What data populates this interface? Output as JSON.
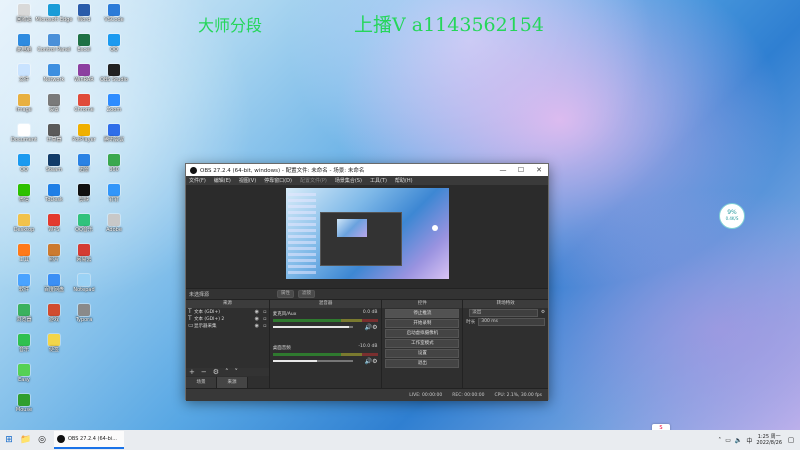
{
  "overlay": {
    "left_text": "大师分段",
    "right_text": "上播V a1143562154"
  },
  "desktop_icons": [
    {
      "label": "回收站",
      "icon": "recycle-bin-icon",
      "color": "#d9d9d9",
      "col": 0,
      "row": 0
    },
    {
      "label": "此电脑",
      "icon": "computer-icon",
      "color": "#2e8be0",
      "col": 0,
      "row": 1
    },
    {
      "label": "文件",
      "icon": "file-icon",
      "color": "#c9e3ff",
      "col": 0,
      "row": 2
    },
    {
      "label": "Image",
      "icon": "image-icon",
      "color": "#e8b040",
      "col": 0,
      "row": 3
    },
    {
      "label": "Document",
      "icon": "document-icon",
      "color": "#ffffff",
      "col": 0,
      "row": 4
    },
    {
      "label": "QQ",
      "icon": "qq-icon",
      "color": "#1b9af0",
      "col": 0,
      "row": 5
    },
    {
      "label": "微信",
      "icon": "wechat-icon",
      "color": "#2dc100",
      "col": 0,
      "row": 6
    },
    {
      "label": "Desktop",
      "icon": "folder-icon",
      "color": "#f1c24b",
      "col": 0,
      "row": 7
    },
    {
      "label": "工具",
      "icon": "tool-icon",
      "color": "#ff7a1a",
      "col": 0,
      "row": 8
    },
    {
      "label": "软件",
      "icon": "app-icon",
      "color": "#4aa3ff",
      "col": 0,
      "row": 9
    },
    {
      "label": "浏览器",
      "icon": "browser-icon",
      "color": "#3bb15e",
      "col": 0,
      "row": 10
    },
    {
      "label": "音乐",
      "icon": "music-icon",
      "color": "#30c050",
      "col": 0,
      "row": 11
    },
    {
      "label": "Easy",
      "icon": "easy-icon",
      "color": "#55d155",
      "col": 0,
      "row": 12
    },
    {
      "label": "Mouse",
      "icon": "mouse-icon",
      "color": "#2f9e2f",
      "col": 0,
      "row": 13
    },
    {
      "label": "Microsoft Edge",
      "icon": "edge-icon",
      "color": "#1a9cd8",
      "col": 1,
      "row": 0
    },
    {
      "label": "Control Panel",
      "icon": "control-panel-icon",
      "color": "#4a90d9",
      "col": 1,
      "row": 1
    },
    {
      "label": "Network",
      "icon": "network-icon",
      "color": "#3d8fe0",
      "col": 1,
      "row": 2
    },
    {
      "label": "设置",
      "icon": "settings-icon",
      "color": "#7a7a7a",
      "col": 1,
      "row": 3
    },
    {
      "label": "计算器",
      "icon": "calculator-icon",
      "color": "#5a5a5a",
      "col": 1,
      "row": 4
    },
    {
      "label": "Steam",
      "icon": "steam-icon",
      "color": "#123c6a",
      "col": 1,
      "row": 5
    },
    {
      "label": "ToDesk",
      "icon": "todesk-icon",
      "color": "#1f7fe6",
      "col": 1,
      "row": 6
    },
    {
      "label": "WPS",
      "icon": "wps-icon",
      "color": "#e33a2e",
      "col": 1,
      "row": 7
    },
    {
      "label": "照片",
      "icon": "photo-icon",
      "color": "#cc7a30",
      "col": 1,
      "row": 8
    },
    {
      "label": "百度网盘",
      "icon": "cloud-icon",
      "color": "#3b8ff5",
      "col": 1,
      "row": 9
    },
    {
      "label": "游戏",
      "icon": "game-icon",
      "color": "#d14c2f",
      "col": 1,
      "row": 10
    },
    {
      "label": "便签",
      "icon": "note-icon",
      "color": "#f3d54a",
      "col": 1,
      "row": 11
    },
    {
      "label": "Word",
      "icon": "word-icon",
      "color": "#2a5caa",
      "col": 2,
      "row": 0
    },
    {
      "label": "Excel",
      "icon": "excel-icon",
      "color": "#1e7145",
      "col": 2,
      "row": 1
    },
    {
      "label": "WinRAR",
      "icon": "winrar-icon",
      "color": "#8c3fa0",
      "col": 2,
      "row": 2
    },
    {
      "label": "Chrome",
      "icon": "chrome-icon",
      "color": "#e04b3a",
      "col": 2,
      "row": 3
    },
    {
      "label": "PotPlayer",
      "icon": "potplayer-icon",
      "color": "#f0b000",
      "col": 2,
      "row": 4
    },
    {
      "label": "迅雷",
      "icon": "xunlei-icon",
      "color": "#2a82e4",
      "col": 2,
      "row": 5
    },
    {
      "label": "剪映",
      "icon": "jianying-icon",
      "color": "#111111",
      "col": 2,
      "row": 6
    },
    {
      "label": "QQ音乐",
      "icon": "qqmusic-icon",
      "color": "#31c27c",
      "col": 2,
      "row": 7
    },
    {
      "label": "网易云",
      "icon": "netease-icon",
      "color": "#d43c33",
      "col": 2,
      "row": 8
    },
    {
      "label": "Notepad",
      "icon": "notepad-icon",
      "color": "#9bd2f5",
      "col": 2,
      "row": 9
    },
    {
      "label": "Typora",
      "icon": "typora-icon",
      "color": "#8a8a8a",
      "col": 2,
      "row": 10
    },
    {
      "label": "VSCode",
      "icon": "vscode-icon",
      "color": "#2b7bd8",
      "col": 3,
      "row": 0
    },
    {
      "label": "QQ",
      "icon": "qq2-icon",
      "color": "#1b9af0",
      "col": 3,
      "row": 1
    },
    {
      "label": "OBS Studio",
      "icon": "obs-icon",
      "color": "#222222",
      "col": 3,
      "row": 2
    },
    {
      "label": "Zoom",
      "icon": "zoom-icon",
      "color": "#2d8cff",
      "col": 3,
      "row": 3
    },
    {
      "label": "腾讯会议",
      "icon": "meeting-icon",
      "color": "#2f6ee9",
      "col": 3,
      "row": 4
    },
    {
      "label": "360",
      "icon": "360-icon",
      "color": "#3aa84e",
      "col": 3,
      "row": 5
    },
    {
      "label": "钉钉",
      "icon": "dingtalk-icon",
      "color": "#3296fa",
      "col": 3,
      "row": 6
    },
    {
      "label": "Adobe",
      "icon": "adobe-icon",
      "color": "#c8c8c8",
      "col": 3,
      "row": 7
    }
  ],
  "widget": {
    "percent": "9%",
    "speed": "0.4K/S"
  },
  "obs": {
    "title": "OBS 27.2.4 (64-bit, windows) - 配置文件: 未命名 - 场景: 未命名",
    "controls": [
      "—",
      "☐",
      "✕"
    ],
    "menu": [
      "文件(F)",
      "编辑(E)",
      "视图(V)",
      "停靠窗口(D)",
      "配置文件(P)",
      "场景集合(S)",
      "工具(T)",
      "帮助(H)"
    ],
    "scene_bar": {
      "label": "未选择源",
      "props_btn": "属性",
      "filters_btn": "滤镜"
    },
    "docks": {
      "sources": {
        "header": "来源",
        "items": [
          {
            "icon": "T",
            "name": "文本 (GDI+)"
          },
          {
            "icon": "T",
            "name": "文本 (GDI+) 2"
          },
          {
            "icon": "▭",
            "name": "显示器采集"
          }
        ],
        "tabs": [
          "场景",
          "来源"
        ]
      },
      "mixer": {
        "header": "混音器",
        "channels": [
          {
            "name": "麦克风/Aux",
            "db": "0.0 dB",
            "level": 0.95
          },
          {
            "name": "桌面音频",
            "db": "-10.0 dB",
            "level": 0.55
          }
        ]
      },
      "controls": {
        "header": "控件",
        "buttons": [
          "停止推流",
          "开始录制",
          "启动虚拟摄像机",
          "工作室模式",
          "设置",
          "退出"
        ]
      },
      "transitions": {
        "header": "转场特效",
        "type_value": "淡出",
        "duration_label": "时长",
        "duration_value": "300 ms"
      }
    },
    "status": [
      "LIVE: 00:00:00",
      "REC: 00:00:00",
      "CPU: 2.1%, 30.00 fps"
    ]
  },
  "taskbar": {
    "obs_label": "OBS 27.2.4 (64-bi...",
    "time": "1:25 周一",
    "date": "2022/8/26",
    "ime": "中",
    "sogou": "S"
  }
}
